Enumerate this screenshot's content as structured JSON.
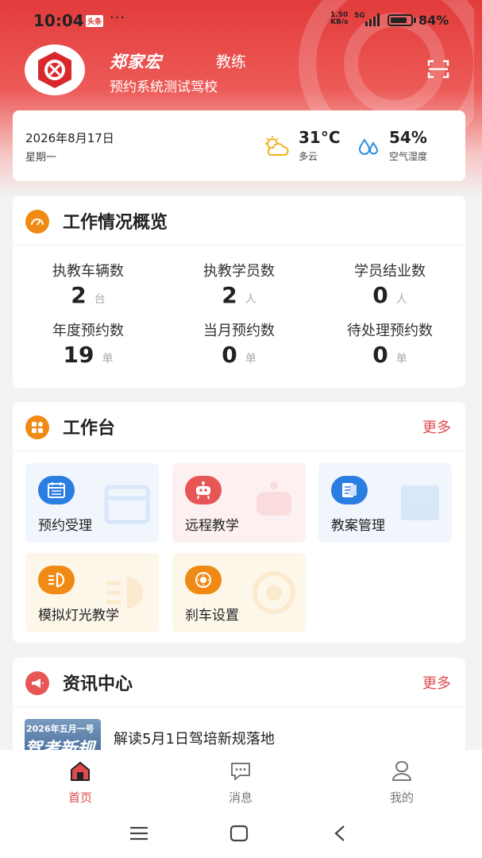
{
  "status_bar": {
    "time": "10:04",
    "badge": "头条",
    "dots": "···",
    "net_speed": "1.50",
    "net_unit": "KB/s",
    "network": "5G",
    "battery": "84%"
  },
  "profile": {
    "name": "郑家宏",
    "role": "教练",
    "school": "预约系统测试驾校"
  },
  "weather": {
    "date": "2026年8月17日",
    "weekday": "星期一",
    "temperature": "31°C",
    "condition": "多云",
    "humidity": "54%",
    "humidity_label": "空气湿度"
  },
  "overview": {
    "title": "工作情况概览",
    "stats": [
      {
        "label": "执教车辆数",
        "value": "2",
        "unit": "台"
      },
      {
        "label": "执教学员数",
        "value": "2",
        "unit": "人"
      },
      {
        "label": "学员结业数",
        "value": "0",
        "unit": "人"
      },
      {
        "label": "年度预约数",
        "value": "19",
        "unit": "单"
      },
      {
        "label": "当月预约数",
        "value": "0",
        "unit": "单"
      },
      {
        "label": "待处理预约数",
        "value": "0",
        "unit": "单"
      }
    ]
  },
  "workbench": {
    "title": "工作台",
    "more": "更多",
    "tiles": [
      {
        "label": "预约受理",
        "icon": "calendar-icon",
        "bg": "#f1f6fd",
        "color": "#2a7de1"
      },
      {
        "label": "远程教学",
        "icon": "robot-icon",
        "bg": "#fdf0f0",
        "color": "#e85555"
      },
      {
        "label": "教案管理",
        "icon": "lesson-plan-icon",
        "bg": "#f1f6fd",
        "color": "#2a7de1"
      },
      {
        "label": "模拟灯光教学",
        "icon": "headlight-icon",
        "bg": "#fdf7ea",
        "color": "#f08a14"
      },
      {
        "label": "刹车设置",
        "icon": "brake-disc-icon",
        "bg": "#fdf7ea",
        "color": "#f08a14"
      }
    ]
  },
  "news": {
    "title": "资讯中心",
    "more": "更多",
    "items": [
      {
        "title": "解读5月1日驾培新规落地",
        "thumb_line1": "2026年五月一号",
        "thumb_line2": "驾考新规"
      }
    ]
  },
  "bottom_nav": {
    "items": [
      {
        "label": "首页",
        "icon": "home-icon",
        "active": true
      },
      {
        "label": "消息",
        "icon": "message-icon",
        "active": false
      },
      {
        "label": "我的",
        "icon": "profile-icon",
        "active": false
      }
    ]
  },
  "colors": {
    "brand_red": "#e23b3b",
    "accent_orange": "#f08a14",
    "more_link": "#e04a4a"
  }
}
